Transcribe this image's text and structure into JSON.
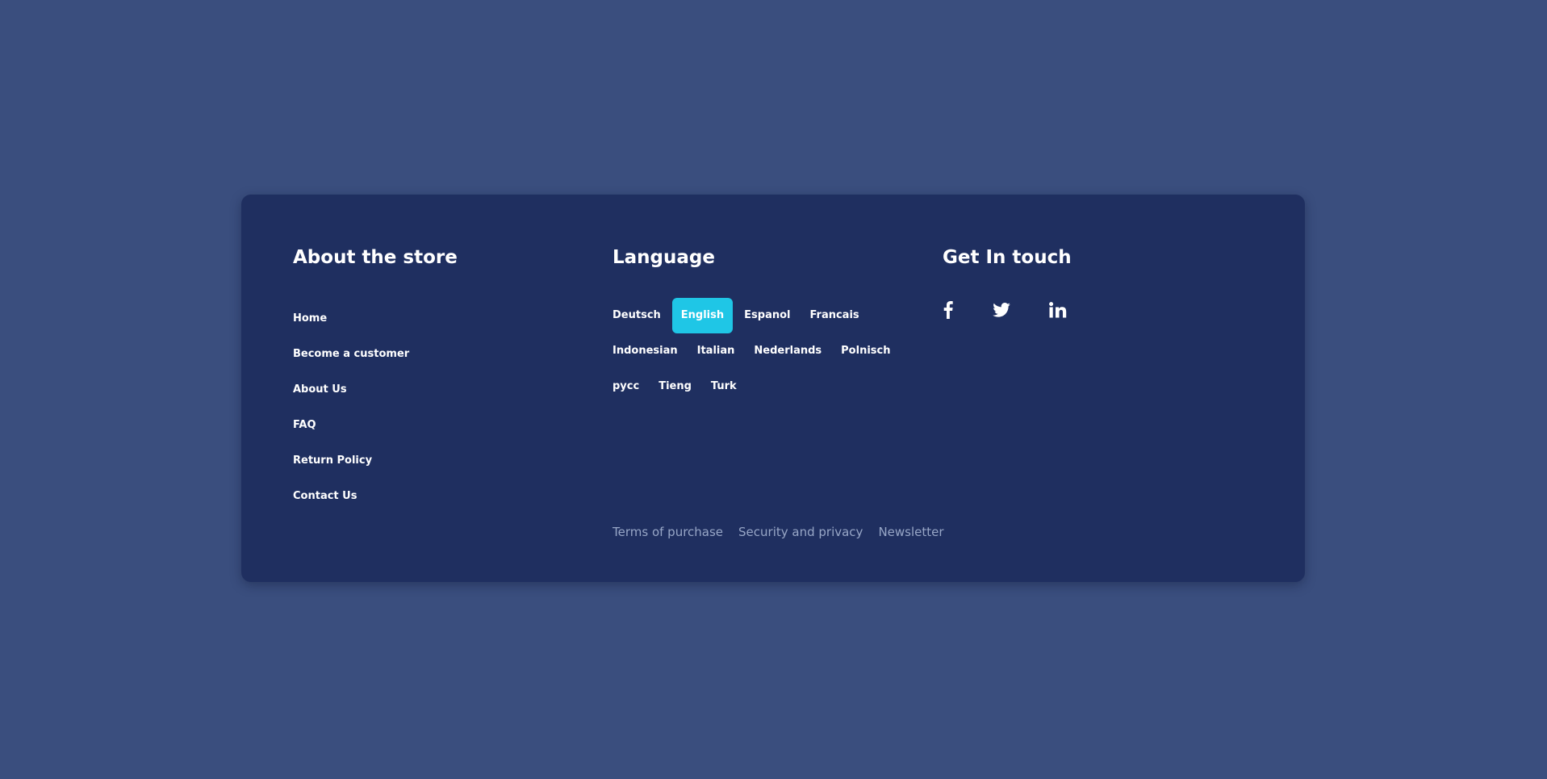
{
  "about": {
    "title": "About the store",
    "links": [
      "Home",
      "Become a customer",
      "About Us",
      "FAQ",
      "Return Policy",
      "Contact Us"
    ]
  },
  "language": {
    "title": "Language",
    "selected": "English",
    "rows": [
      [
        "Deutsch",
        "English",
        "Espanol",
        "Francais"
      ],
      [
        "Indonesian",
        "Italian",
        "Nederlands",
        "Polnisch"
      ],
      [
        "pycc",
        "Tieng",
        "Turk"
      ]
    ]
  },
  "contact": {
    "title": "Get In touch",
    "icons": [
      "facebook-icon",
      "twitter-icon",
      "linkedin-icon"
    ]
  },
  "legal": {
    "links": [
      "Terms of purchase",
      "Security and privacy",
      "Newsletter"
    ]
  },
  "colors": {
    "page_background": "#3a4e7e",
    "card_background": "#1f2f60",
    "accent": "#1fc6e6",
    "muted_text": "#97a6c6"
  }
}
